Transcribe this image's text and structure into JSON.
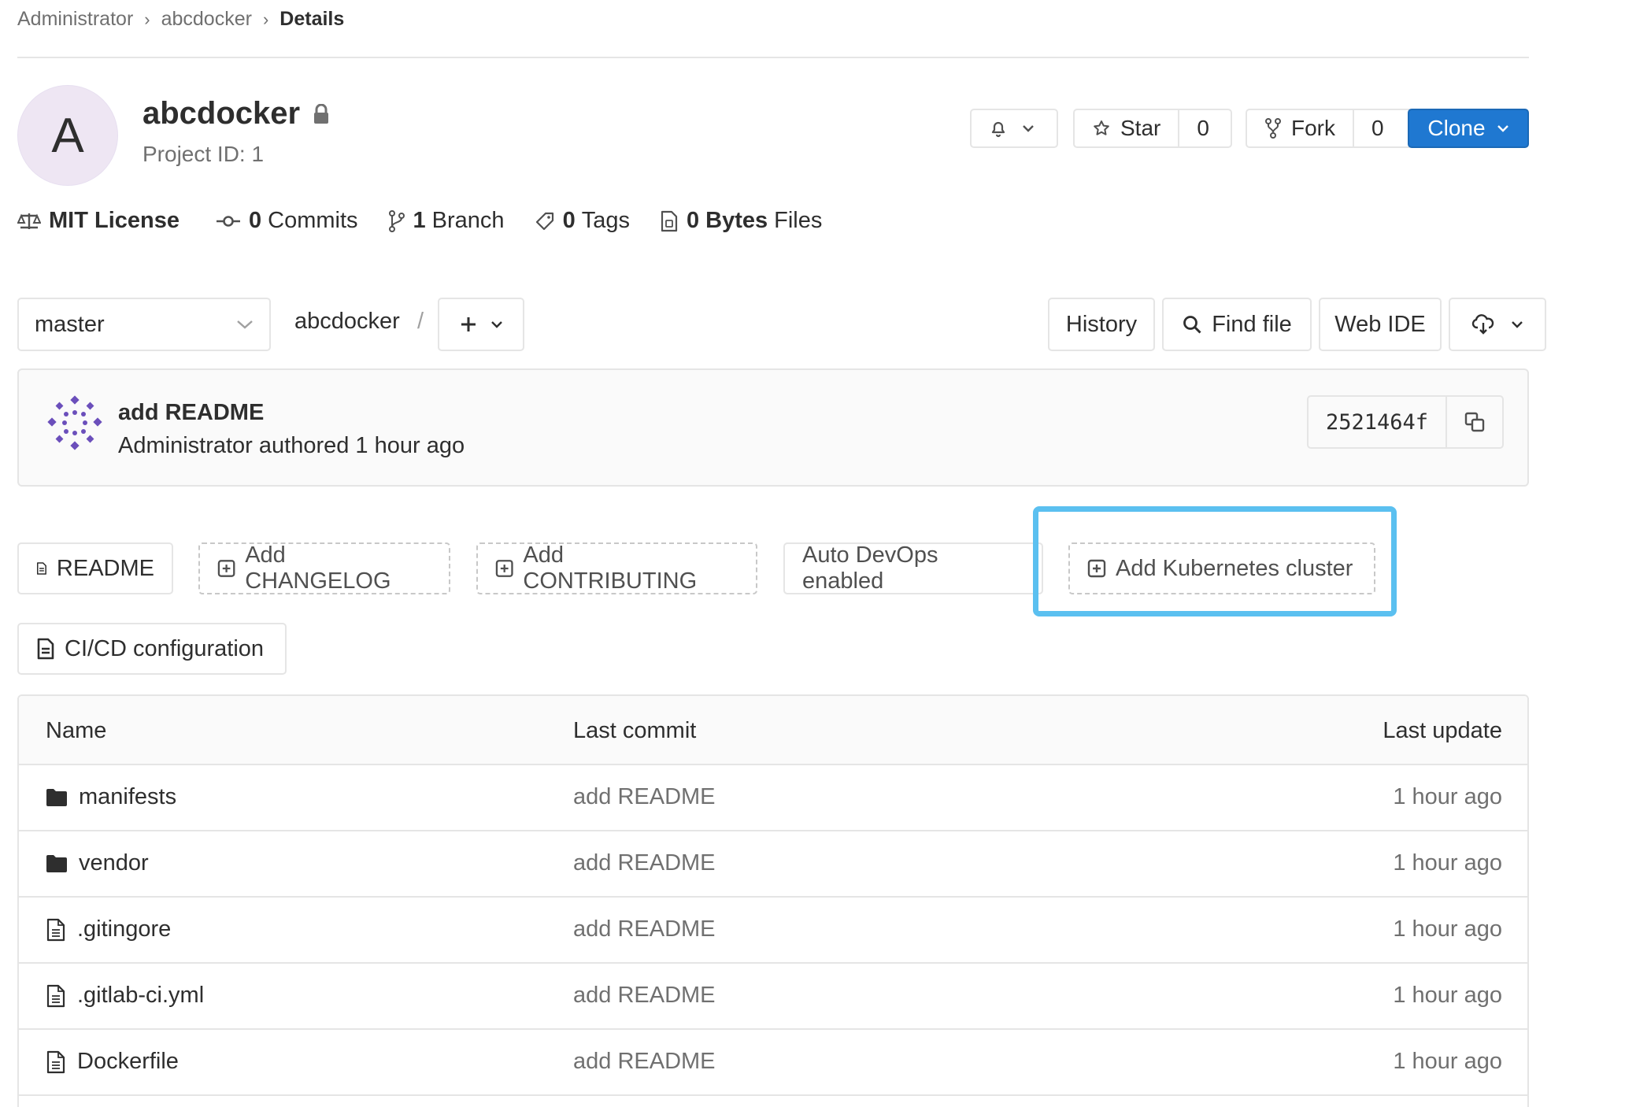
{
  "breadcrumb": {
    "items": [
      "Administrator",
      "abcdocker"
    ],
    "current": "Details"
  },
  "project": {
    "avatar_letter": "A",
    "name": "abcdocker",
    "id_label": "Project ID: 1",
    "actions": {
      "star_label": "Star",
      "star_count": "0",
      "fork_label": "Fork",
      "fork_count": "0",
      "clone_label": "Clone"
    },
    "stats": {
      "license": "MIT License",
      "commits_count": "0",
      "commits_label": "Commits",
      "branch_count": "1",
      "branch_label": "Branch",
      "tags_count": "0",
      "tags_label": "Tags",
      "files_size": "0 Bytes",
      "files_label": "Files"
    }
  },
  "toolbar": {
    "branch": "master",
    "path": "abcdocker",
    "path_sep": "/",
    "history": "History",
    "find_file": "Find file",
    "web_ide": "Web IDE"
  },
  "commit": {
    "title": "add README",
    "meta": "Administrator authored 1 hour ago",
    "sha": "2521464f"
  },
  "quick_actions": {
    "readme": "README",
    "add_changelog": "Add CHANGELOG",
    "add_contributing": "Add CONTRIBUTING",
    "auto_devops": "Auto DevOps enabled",
    "add_k8s": "Add Kubernetes cluster",
    "cicd": "CI/CD configuration"
  },
  "table": {
    "headers": {
      "name": "Name",
      "last_commit": "Last commit",
      "last_update": "Last update"
    },
    "rows": [
      {
        "type": "folder",
        "name": "manifests",
        "last_commit": "add README",
        "last_update": "1 hour ago"
      },
      {
        "type": "folder",
        "name": "vendor",
        "last_commit": "add README",
        "last_update": "1 hour ago"
      },
      {
        "type": "file",
        "name": ".gitingore",
        "last_commit": "add README",
        "last_update": "1 hour ago"
      },
      {
        "type": "file",
        "name": ".gitlab-ci.yml",
        "last_commit": "add README",
        "last_update": "1 hour ago"
      },
      {
        "type": "file",
        "name": "Dockerfile",
        "last_commit": "add README",
        "last_update": "1 hour ago"
      }
    ]
  },
  "colors": {
    "primary": "#1f78d1",
    "highlight": "#5bc0f0",
    "border": "#e5e5e5",
    "muted": "#707070"
  }
}
